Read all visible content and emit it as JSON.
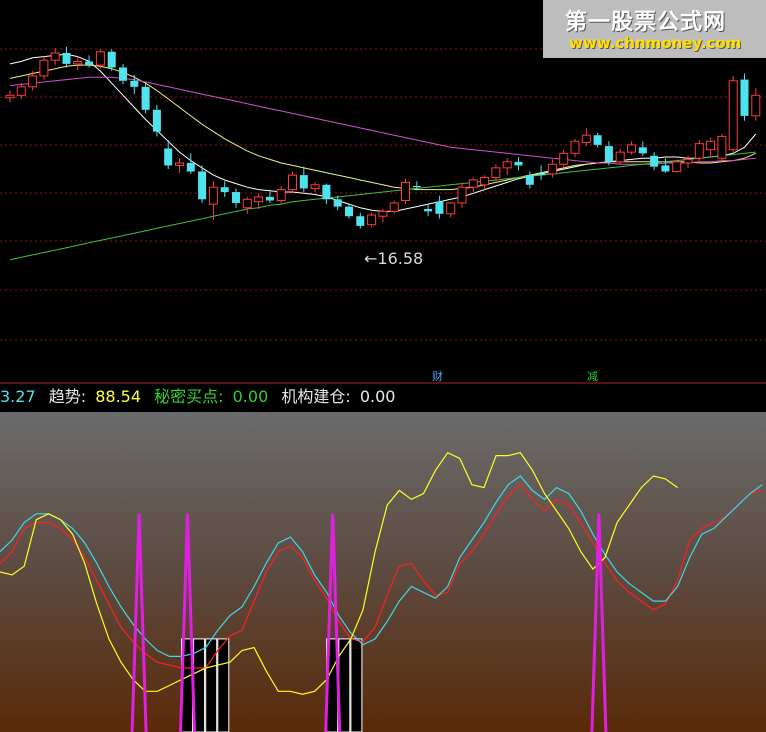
{
  "watermark": {
    "title": "第一股票公式网",
    "url": "www.chnmoney.com"
  },
  "price_chart": {
    "low_label": "←16.58",
    "event_marks": [
      {
        "text": "财",
        "color": "#4aa0ff"
      },
      {
        "text": "减",
        "color": "#33cc33"
      }
    ]
  },
  "status_bar": {
    "first_value": "3.27",
    "trend_label": "趋势:",
    "trend_value": "88.54",
    "buy_label": "秘密买点:",
    "buy_value": "0.00",
    "inst_label": "机构建仓:",
    "inst_value": "0.00"
  },
  "colors": {
    "up": "#ff3b3b",
    "down": "#4fe3ef",
    "ma_white": "#ffffff",
    "ma_yellow": "#f0f080",
    "ma_magenta": "#d050d0",
    "ma_green": "#40c040",
    "trend": "#ffff20",
    "buy": "#20e020"
  },
  "chart_data": [
    {
      "type": "candlestick",
      "candles": [
        [
          27.4,
          28.0,
          27.0,
          27.6
        ],
        [
          27.6,
          28.6,
          27.3,
          28.3
        ],
        [
          28.3,
          29.6,
          28.0,
          29.2
        ],
        [
          29.2,
          30.8,
          28.9,
          30.5
        ],
        [
          30.5,
          31.5,
          30.1,
          31.1
        ],
        [
          31.1,
          31.6,
          29.9,
          30.2
        ],
        [
          30.2,
          30.8,
          29.7,
          30.4
        ],
        [
          30.4,
          30.9,
          29.9,
          30.1
        ],
        [
          30.1,
          31.4,
          29.8,
          31.2
        ],
        [
          31.2,
          31.4,
          29.6,
          29.9
        ],
        [
          29.9,
          30.2,
          28.5,
          28.8
        ],
        [
          28.8,
          29.3,
          27.7,
          28.3
        ],
        [
          28.3,
          28.6,
          26.1,
          26.4
        ],
        [
          26.4,
          26.8,
          24.2,
          24.6
        ],
        [
          23.2,
          23.9,
          21.5,
          21.8
        ],
        [
          21.8,
          22.4,
          21.2,
          22.0
        ],
        [
          22.0,
          22.8,
          21.1,
          21.3
        ],
        [
          21.3,
          21.8,
          18.7,
          19.0
        ],
        [
          18.6,
          20.5,
          17.3,
          20.0
        ],
        [
          20.0,
          20.5,
          19.2,
          19.6
        ],
        [
          19.6,
          19.9,
          18.3,
          18.7
        ],
        [
          18.3,
          19.2,
          17.8,
          19.0
        ],
        [
          18.8,
          19.5,
          18.2,
          19.2
        ],
        [
          19.2,
          19.8,
          18.7,
          18.9
        ],
        [
          18.9,
          20.1,
          18.6,
          19.8
        ],
        [
          19.8,
          21.3,
          19.5,
          21.0
        ],
        [
          21.0,
          21.7,
          19.6,
          19.9
        ],
        [
          19.9,
          20.4,
          19.6,
          20.2
        ],
        [
          20.2,
          20.3,
          18.6,
          19.0
        ],
        [
          19.0,
          19.3,
          18.1,
          18.4
        ],
        [
          18.4,
          18.6,
          17.4,
          17.6
        ],
        [
          17.6,
          17.9,
          16.58,
          16.8
        ],
        [
          16.9,
          17.9,
          16.7,
          17.7
        ],
        [
          17.6,
          18.2,
          17.1,
          18.0
        ],
        [
          18.0,
          18.9,
          17.8,
          18.7
        ],
        [
          18.9,
          20.7,
          18.6,
          20.4
        ],
        [
          20.1,
          20.5,
          19.8,
          20.0
        ],
        [
          18.2,
          18.6,
          17.6,
          18.0
        ],
        [
          18.8,
          19.3,
          17.4,
          17.8
        ],
        [
          17.8,
          18.8,
          17.5,
          18.7
        ],
        [
          18.7,
          20.4,
          18.3,
          20.0
        ],
        [
          20.0,
          20.8,
          19.6,
          20.6
        ],
        [
          20.2,
          21.0,
          19.8,
          20.8
        ],
        [
          20.8,
          21.9,
          20.5,
          21.6
        ],
        [
          21.6,
          22.4,
          21.0,
          22.1
        ],
        [
          22.1,
          22.5,
          21.4,
          21.8
        ],
        [
          21.0,
          21.3,
          19.9,
          20.2
        ],
        [
          21.1,
          21.8,
          20.6,
          21.0
        ],
        [
          21.1,
          22.3,
          20.8,
          21.9
        ],
        [
          21.9,
          23.1,
          21.6,
          22.8
        ],
        [
          22.8,
          24.0,
          22.5,
          23.8
        ],
        [
          23.7,
          24.9,
          23.4,
          24.3
        ],
        [
          24.3,
          24.5,
          23.3,
          23.5
        ],
        [
          23.4,
          23.8,
          21.8,
          22.1
        ],
        [
          22.1,
          23.2,
          21.9,
          22.9
        ],
        [
          22.9,
          23.8,
          22.7,
          23.5
        ],
        [
          23.3,
          23.8,
          22.6,
          22.8
        ],
        [
          22.6,
          22.9,
          21.4,
          21.7
        ],
        [
          21.8,
          22.4,
          21.2,
          21.3
        ],
        [
          21.3,
          22.3,
          21.2,
          22.1
        ],
        [
          22.0,
          22.6,
          21.6,
          22.3
        ],
        [
          22.4,
          23.9,
          22.0,
          23.6
        ],
        [
          23.1,
          24.1,
          22.5,
          23.8
        ],
        [
          22.4,
          24.4,
          22.2,
          24.2
        ],
        [
          23.1,
          29.2,
          22.9,
          28.8
        ],
        [
          28.9,
          29.4,
          25.5,
          25.9
        ],
        [
          25.9,
          28.2,
          25.5,
          27.6
        ]
      ],
      "ma_series": [
        {
          "values": [
            30.2,
            30.4,
            30.7,
            30.8,
            30.9,
            31.0,
            30.8,
            30.4,
            29.6,
            28.6,
            27.6,
            26.6,
            25.6,
            24.7,
            23.8,
            22.9,
            22.2,
            21.6,
            21.0,
            20.6,
            20.3,
            20.0,
            19.8,
            19.7,
            19.6,
            19.6,
            19.5,
            19.4,
            19.2,
            18.9,
            18.6,
            18.3,
            18.1,
            18.0,
            18.0,
            18.2,
            18.4,
            18.6,
            18.8,
            19.0,
            19.2,
            19.5,
            19.8,
            20.1,
            20.4,
            20.7,
            20.9,
            21.1,
            21.3,
            21.5,
            21.7,
            21.9,
            22.0,
            22.1,
            22.2,
            22.3,
            22.4,
            22.4,
            22.5,
            22.5,
            22.4,
            22.4,
            22.5,
            22.6,
            22.8,
            23.3,
            24.4
          ]
        },
        {
          "values": [
            29.0,
            29.2,
            29.4,
            29.6,
            29.8,
            30.0,
            30.1,
            30.1,
            30.0,
            29.8,
            29.5,
            29.1,
            28.6,
            28.0,
            27.3,
            26.6,
            25.9,
            25.2,
            24.6,
            24.0,
            23.5,
            23.0,
            22.6,
            22.3,
            22.0,
            21.8,
            21.6,
            21.4,
            21.2,
            21.0,
            20.8,
            20.6,
            20.4,
            20.2,
            20.0,
            19.9,
            19.8,
            19.8,
            19.8,
            19.8,
            19.9,
            20.0,
            20.2,
            20.4,
            20.6,
            20.8,
            21.0,
            21.2,
            21.4,
            21.6,
            21.8,
            21.9,
            22.0,
            22.1,
            22.1,
            22.1,
            22.1,
            22.1,
            22.1,
            22.1,
            22.1,
            22.0,
            22.0,
            22.1,
            22.2,
            22.4,
            22.8
          ]
        },
        {
          "values": [
            28.4,
            28.5,
            28.6,
            28.7,
            28.8,
            28.9,
            29.0,
            29.1,
            29.1,
            29.1,
            29.0,
            28.9,
            28.7,
            28.5,
            28.3,
            28.1,
            27.9,
            27.7,
            27.5,
            27.3,
            27.1,
            26.9,
            26.7,
            26.5,
            26.3,
            26.1,
            25.9,
            25.7,
            25.5,
            25.3,
            25.1,
            24.9,
            24.7,
            24.5,
            24.3,
            24.1,
            23.9,
            23.7,
            23.5,
            23.3,
            23.2,
            23.1,
            23.0,
            22.9,
            22.8,
            22.7,
            22.6,
            22.5,
            22.4,
            22.3,
            22.2,
            22.1,
            22.0,
            22.0,
            21.9,
            21.9,
            21.9,
            21.9,
            22.0,
            22.0,
            22.0,
            22.1,
            22.1,
            22.2,
            22.2,
            22.3,
            22.4
          ]
        },
        {
          "values": [
            14.0,
            14.2,
            14.4,
            14.6,
            14.8,
            15.0,
            15.2,
            15.4,
            15.6,
            15.8,
            16.0,
            16.2,
            16.4,
            16.6,
            16.8,
            17.0,
            17.2,
            17.4,
            17.6,
            17.8,
            18.0,
            18.2,
            18.3,
            18.5,
            18.6,
            18.8,
            18.9,
            19.0,
            19.1,
            19.2,
            19.3,
            19.4,
            19.5,
            19.6,
            19.7,
            19.8,
            19.9,
            20.0,
            20.1,
            20.2,
            20.3,
            20.4,
            20.5,
            20.6,
            20.7,
            20.8,
            20.9,
            21.0,
            21.1,
            21.2,
            21.3,
            21.4,
            21.5,
            21.6,
            21.7,
            21.8,
            21.9,
            22.0,
            22.1,
            22.2,
            22.3,
            22.4,
            22.5,
            22.6,
            22.7,
            22.8,
            22.9
          ]
        }
      ],
      "annotation": {
        "low": 16.58
      }
    },
    {
      "type": "line",
      "x": [
        0,
        1,
        2,
        3,
        4,
        5,
        6,
        7,
        8,
        9,
        10,
        11,
        12,
        13,
        14,
        15,
        16,
        17,
        18,
        19,
        20,
        21,
        22,
        23,
        24,
        25,
        26,
        27,
        28,
        29,
        30,
        31,
        32,
        33,
        34,
        35,
        36,
        37,
        38,
        39,
        40,
        41,
        42,
        43,
        44,
        45,
        46,
        47,
        48,
        49,
        50,
        51,
        52,
        53,
        54,
        55,
        56,
        57,
        58,
        59,
        60,
        61,
        62,
        63
      ],
      "series": [
        {
          "values": [
            58,
            62,
            70,
            72,
            72,
            70,
            66,
            60,
            52,
            44,
            36,
            31,
            27,
            24,
            23,
            22,
            22,
            22,
            28,
            33,
            35,
            45,
            55,
            62,
            64,
            60,
            52,
            46,
            38,
            32,
            31,
            36,
            47,
            57,
            58,
            52,
            47,
            48,
            58,
            62,
            68,
            75,
            81,
            85,
            80,
            76,
            80,
            78,
            72,
            65,
            58,
            52,
            48,
            45,
            42,
            44,
            52,
            66,
            70,
            72,
            74,
            78,
            82,
            83
          ]
        },
        {
          "values": [
            62,
            66,
            72,
            75,
            75,
            73,
            70,
            65,
            58,
            50,
            43,
            37,
            32,
            28,
            26,
            26,
            27,
            29,
            35,
            40,
            43,
            50,
            58,
            65,
            67,
            62,
            54,
            48,
            40,
            34,
            30,
            32,
            38,
            45,
            50,
            48,
            46,
            50,
            60,
            66,
            72,
            79,
            85,
            88,
            83,
            80,
            84,
            82,
            76,
            68,
            61,
            55,
            51,
            48,
            45,
            45,
            50,
            60,
            68,
            70,
            74,
            78,
            82,
            85
          ]
        },
        {
          "values": [
            55,
            54,
            57,
            73,
            75,
            73,
            68,
            58,
            44,
            32,
            24,
            18,
            14,
            14,
            16,
            18,
            20,
            22,
            23,
            24,
            28,
            29,
            21,
            14,
            14,
            13,
            14,
            18,
            26,
            32,
            42,
            62,
            78,
            83,
            80,
            82,
            90,
            96,
            94,
            85,
            84,
            95,
            95,
            96,
            90,
            82,
            76,
            70,
            62,
            56,
            60,
            72,
            78,
            84,
            88,
            87,
            84
          ]
        }
      ],
      "spikes": [
        11,
        15,
        27,
        49
      ],
      "bars": [
        15,
        16,
        17,
        18,
        27,
        28,
        29
      ]
    }
  ]
}
